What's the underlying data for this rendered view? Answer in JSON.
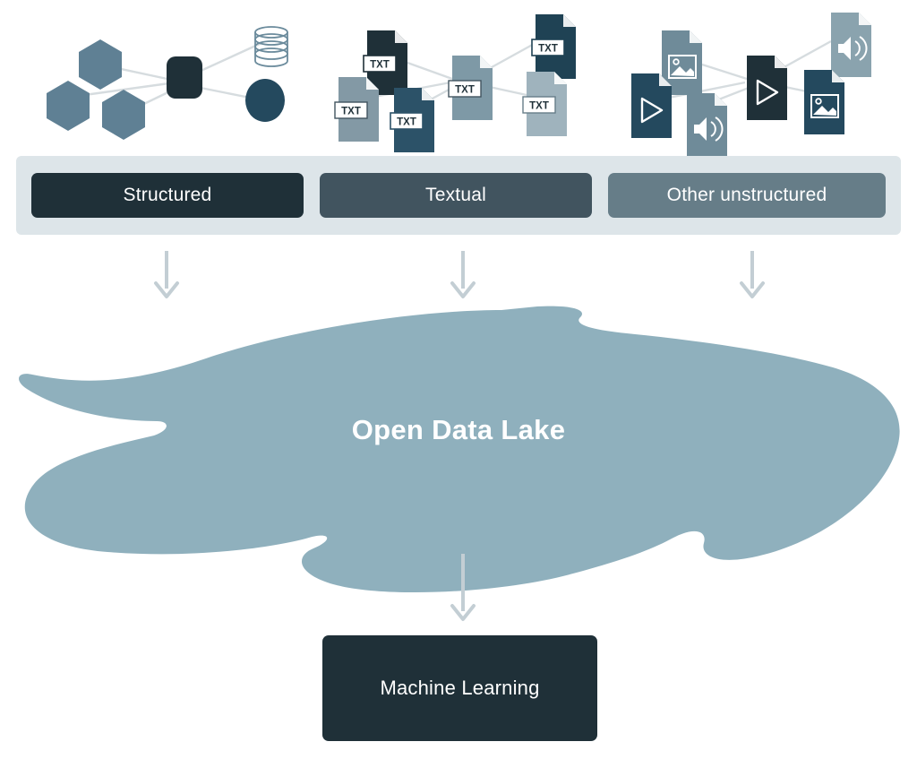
{
  "diagram": {
    "title": "Open Data Lake",
    "background": "#ffffff"
  },
  "palette": {
    "dark": "#1f3038",
    "mid_dark": "#41545f",
    "mid": "#5f8094",
    "slate": "#667d88",
    "light_slate": "#90a7b3",
    "lake": "#8fb0bd",
    "bar_bg": "#dde5e9",
    "arrow": "#c3ced4",
    "connector": "#d6dcdf",
    "white": "#ffffff",
    "deep_blue": "#24495e"
  },
  "categories": {
    "items": [
      {
        "id": "structured",
        "label": "Structured",
        "color": "#1f3038"
      },
      {
        "id": "textual",
        "label": "Textual",
        "color": "#41545f"
      },
      {
        "id": "other",
        "label": "Other unstructured",
        "color": "#667d88"
      }
    ]
  },
  "lake": {
    "label": "Open Data Lake",
    "color": "#8fb0bd"
  },
  "output": {
    "label": "Machine Learning",
    "color": "#1f3038"
  },
  "arrows": {
    "color": "#c3ced4",
    "down_from_structured": "arrow-down-icon",
    "down_from_textual": "arrow-down-icon",
    "down_from_other": "arrow-down-icon",
    "down_to_ml": "arrow-down-icon"
  },
  "clusters": [
    {
      "id": "structured-cluster",
      "name": "structured-data-cluster",
      "nodes": [
        {
          "icon": "hexagon-icon",
          "color": "#5f8094"
        },
        {
          "icon": "hexagon-icon",
          "color": "#5f8094"
        },
        {
          "icon": "hexagon-icon",
          "color": "#5f8094"
        },
        {
          "icon": "rounded-square-node-icon",
          "color": "#1f3038"
        },
        {
          "icon": "database-cylinder-icon",
          "color": "#5f8094"
        },
        {
          "icon": "circle-node-icon",
          "color": "#24495e"
        }
      ]
    },
    {
      "id": "textual-cluster",
      "name": "textual-data-cluster",
      "nodes": [
        {
          "icon": "txt-file-icon",
          "badge": "TXT",
          "color": "#1f3038"
        },
        {
          "icon": "txt-file-icon",
          "badge": "TXT",
          "color": "#8399a5"
        },
        {
          "icon": "txt-file-icon",
          "badge": "TXT",
          "color": "#2c5268"
        },
        {
          "icon": "txt-file-icon",
          "badge": "TXT",
          "color": "#7e99a6"
        },
        {
          "icon": "txt-file-icon",
          "badge": "TXT",
          "color": "#1f4254"
        },
        {
          "icon": "txt-file-icon",
          "badge": "TXT",
          "color": "#9fb3bd"
        }
      ]
    },
    {
      "id": "other-cluster",
      "name": "other-unstructured-data-cluster",
      "nodes": [
        {
          "icon": "image-file-icon",
          "color": "#6f8b99"
        },
        {
          "icon": "video-file-icon",
          "color": "#24495e"
        },
        {
          "icon": "audio-file-icon",
          "color": "#6f8b99"
        },
        {
          "icon": "video-file-icon",
          "color": "#1f3038"
        },
        {
          "icon": "audio-file-icon",
          "color": "#8aa3ae"
        },
        {
          "icon": "image-file-icon",
          "color": "#24495e"
        }
      ]
    }
  ],
  "chart_data": {
    "type": "diagram",
    "title": "Open Data Lake",
    "flow": [
      {
        "from": "Structured",
        "to": "Open Data Lake"
      },
      {
        "from": "Textual",
        "to": "Open Data Lake"
      },
      {
        "from": "Other unstructured",
        "to": "Open Data Lake"
      },
      {
        "from": "Open Data Lake",
        "to": "Machine Learning"
      }
    ],
    "nodes": [
      "Structured",
      "Textual",
      "Other unstructured",
      "Open Data Lake",
      "Machine Learning"
    ]
  }
}
